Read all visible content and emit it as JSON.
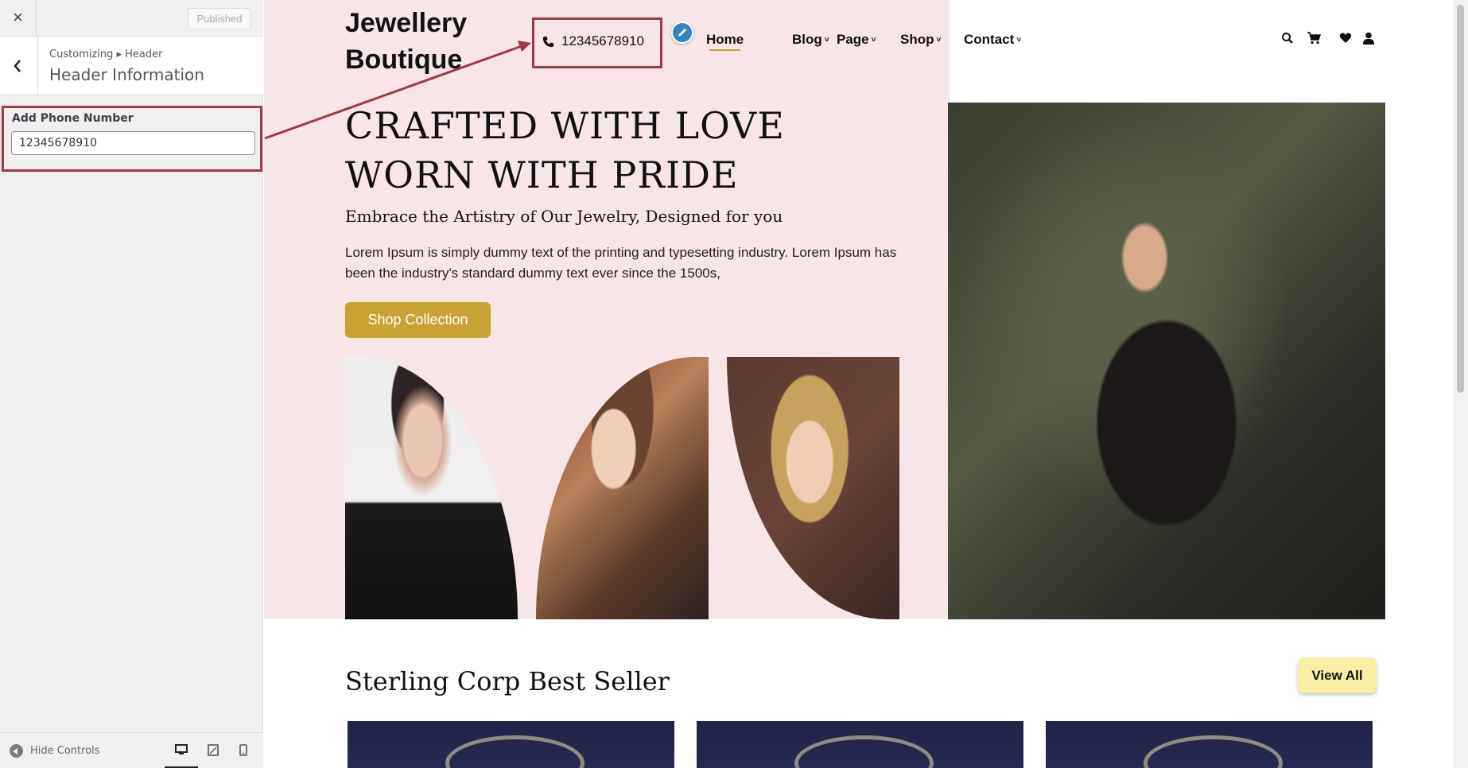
{
  "customizer": {
    "close_symbol": "×",
    "published_label": "Published",
    "breadcrumb": "Customizing ▸ Header",
    "section_title": "Header Information",
    "field_label": "Add Phone Number",
    "field_value": "12345678910",
    "hide_controls_label": "Hide Controls",
    "devices": [
      "desktop-icon",
      "tablet-icon",
      "mobile-icon"
    ]
  },
  "site": {
    "logo_line1": "Jewellery",
    "logo_line2": "Boutique",
    "phone": "12345678910",
    "nav": [
      {
        "label": "Home",
        "dropdown": false
      },
      {
        "label": "Blog",
        "dropdown": true
      },
      {
        "label": "Page",
        "dropdown": true
      },
      {
        "label": "Shop",
        "dropdown": true
      },
      {
        "label": "Contact",
        "dropdown": true
      }
    ],
    "caret": "˅",
    "utility_icons": [
      "search-icon",
      "cart-icon",
      "heart-icon",
      "user-icon"
    ]
  },
  "hero": {
    "heading_line1": "CRAFTED WITH LOVE",
    "heading_line2": "WORN WITH PRIDE",
    "subheading": "Embrace the Artistry of Our Jewelry, Designed for you",
    "body": "Lorem Ipsum is simply dummy text of the printing and typesetting industry. Lorem Ipsum has been the industry's standard dummy text ever since the 1500s,",
    "cta": "Shop Collection"
  },
  "best_seller": {
    "title": "Sterling Corp Best Seller",
    "view_all": "View All"
  },
  "colors": {
    "accent_gold": "#c8a233",
    "hero_pink": "#f8e5e7",
    "annotation_red": "#9d3b46",
    "edit_blue": "#3582c4"
  }
}
